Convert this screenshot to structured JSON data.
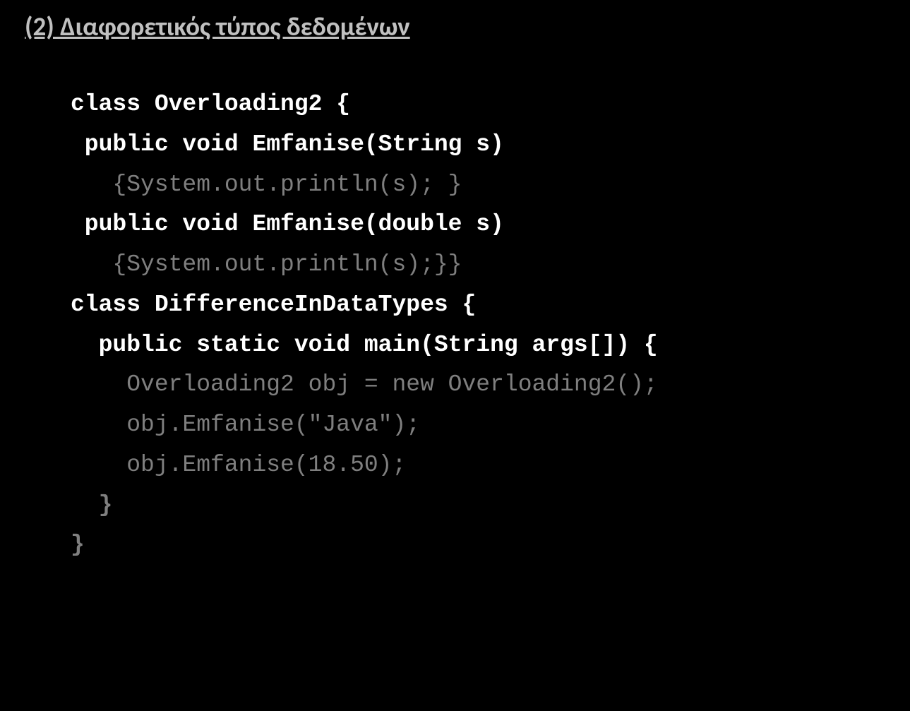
{
  "heading": "(2) Διαφορετικός τύπος δεδομένων",
  "code": {
    "l1": "class Overloading2 {",
    "l2": " public void Emfanise(String s)",
    "l3": "   {System.out.println(s); }",
    "l4": " public void Emfanise(double s)",
    "l5": "   {System.out.println(s);}}",
    "l6": "",
    "l7": "class DifferenceInDataTypes {",
    "l8": "  public static void main(String args[]) {",
    "l9": "    Overloading2 obj = new Overloading2();",
    "l10": "    obj.Emfanise(\"Java\");",
    "l11": "    obj.Emfanise(18.50);",
    "l12": "  }",
    "l13": "}"
  }
}
